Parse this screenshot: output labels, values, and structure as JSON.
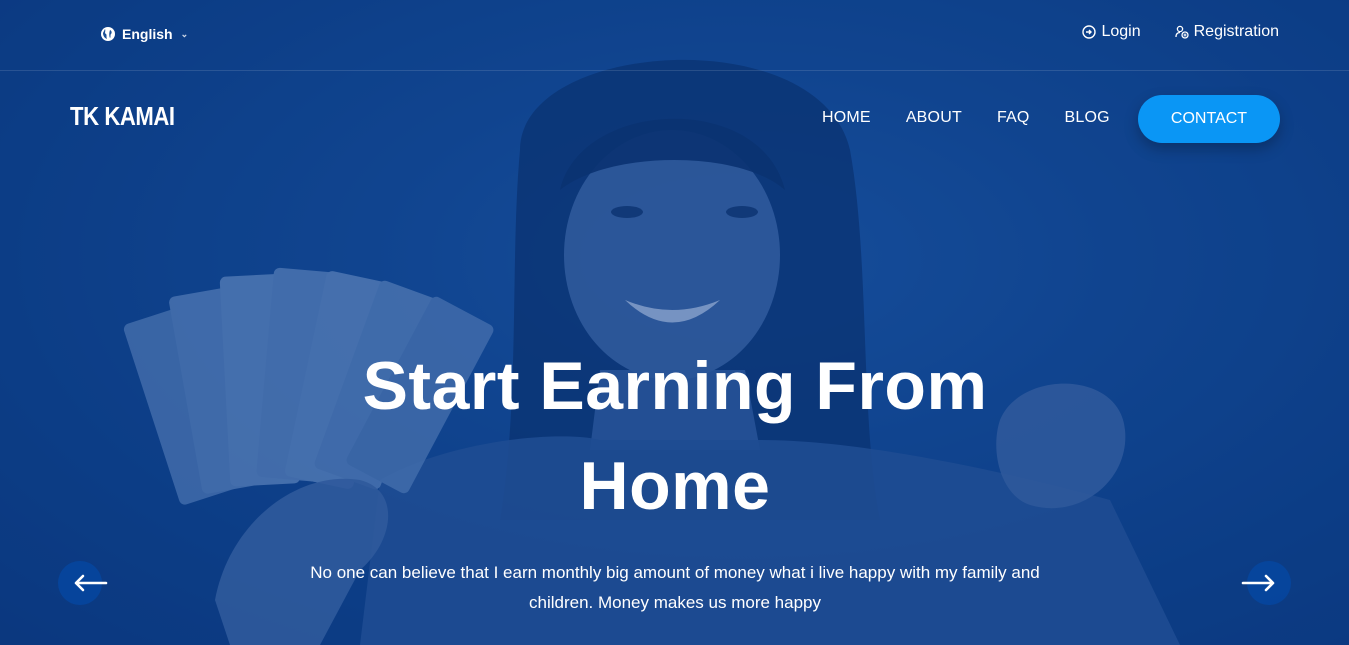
{
  "topbar": {
    "language": "English",
    "login": "Login",
    "registration": "Registration"
  },
  "header": {
    "logo": "TK KAMAI",
    "nav": [
      "HOME",
      "ABOUT",
      "FAQ",
      "BLOG"
    ],
    "contact": "CONTACT"
  },
  "hero": {
    "headline_line1": "Start Earning From",
    "headline_line2": "Home",
    "subtitle_line1": "No one can believe that I earn monthly big amount of money what i live happy with my family and",
    "subtitle_line2": "children. Money makes us more happy"
  },
  "colors": {
    "background": "#0d3f85",
    "accent": "#0a96f5",
    "text": "#ffffff"
  },
  "icons": {
    "language": "globe-icon",
    "login": "login-icon",
    "registration": "user-add-icon",
    "prev": "arrow-left-icon",
    "next": "arrow-right-icon"
  }
}
